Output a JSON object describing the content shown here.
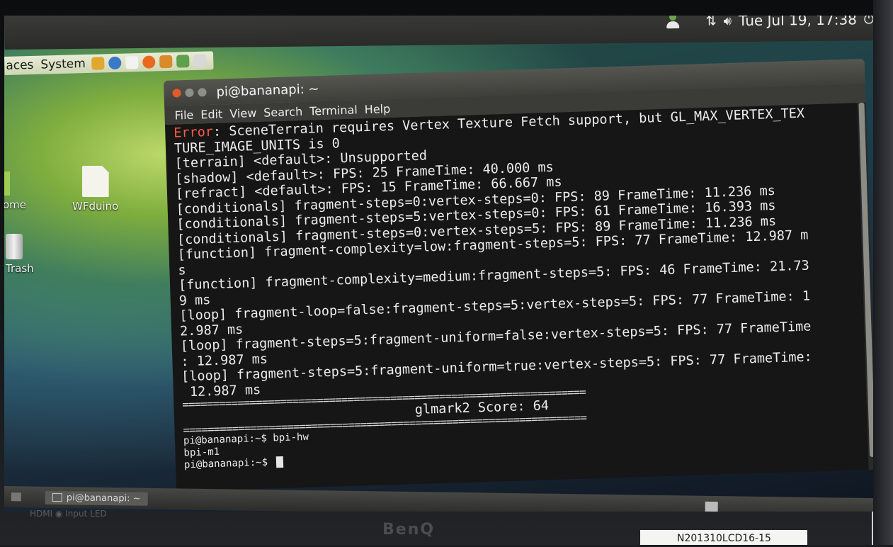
{
  "top_panel": {
    "menus": [
      "aces",
      "System"
    ],
    "clock": "Tue Jul 19, 17:38",
    "icons": [
      "user-icon",
      "network-icon",
      "volume-icon",
      "power-icon"
    ]
  },
  "desktop": {
    "icons": [
      {
        "label": "ome",
        "icon": "home-folder-icon"
      },
      {
        "label": "WFduino",
        "icon": "document-icon"
      },
      {
        "label": "Trash",
        "icon": "trash-icon"
      }
    ]
  },
  "terminal": {
    "title": "pi@bananapi: ~",
    "menu": [
      "File",
      "Edit",
      "View",
      "Search",
      "Terminal",
      "Help"
    ],
    "lines": {
      "l1_err": "Error",
      "l1_rest": ": SceneTerrain requires Vertex Texture Fetch support, but GL_MAX_VERTEX_TEX",
      "l2": "TURE_IMAGE_UNITS is 0",
      "l3": "[terrain] <default>: Unsupported",
      "l4": "[shadow] <default>: FPS: 25 FrameTime: 40.000 ms",
      "l5": "[refract] <default>: FPS: 15 FrameTime: 66.667 ms",
      "l6": "[conditionals] fragment-steps=0:vertex-steps=0: FPS: 89 FrameTime: 11.236 ms",
      "l7": "[conditionals] fragment-steps=5:vertex-steps=0: FPS: 61 FrameTime: 16.393 ms",
      "l8": "[conditionals] fragment-steps=0:vertex-steps=5: FPS: 89 FrameTime: 11.236 ms",
      "l9": "[function] fragment-complexity=low:fragment-steps=5: FPS: 77 FrameTime: 12.987 m",
      "l10": "s",
      "l11": "[function] fragment-complexity=medium:fragment-steps=5: FPS: 46 FrameTime: 21.73",
      "l12": "9 ms",
      "l13": "[loop] fragment-loop=false:fragment-steps=5:vertex-steps=5: FPS: 77 FrameTime: 1",
      "l14": "2.987 ms",
      "l15": "[loop] fragment-steps=5:fragment-uniform=false:vertex-steps=5: FPS: 77 FrameTime",
      "l16": ": 12.987 ms",
      "l17": "[loop] fragment-steps=5:fragment-uniform=true:vertex-steps=5: FPS: 77 FrameTime:",
      "l18": " 12.987 ms",
      "sep1": "==================================================================",
      "score": "glmark2 Score: 64",
      "sep2": "==================================================================",
      "cmd": "pi@bananapi:~$ bpi-hw",
      "output": "bpi-m1",
      "prompt": "pi@bananapi:~$ "
    }
  },
  "bottom_panel": {
    "task_label": "pi@bananapi: ~"
  },
  "bezel": {
    "logo": "BenQ",
    "ports": "HDMI  ◉ Input  LED",
    "sticker": "N201310LCD16-15"
  },
  "colors": {
    "error": "#ff5a44",
    "terminal_bg": "#161616",
    "close_button": "#e05a2a"
  }
}
